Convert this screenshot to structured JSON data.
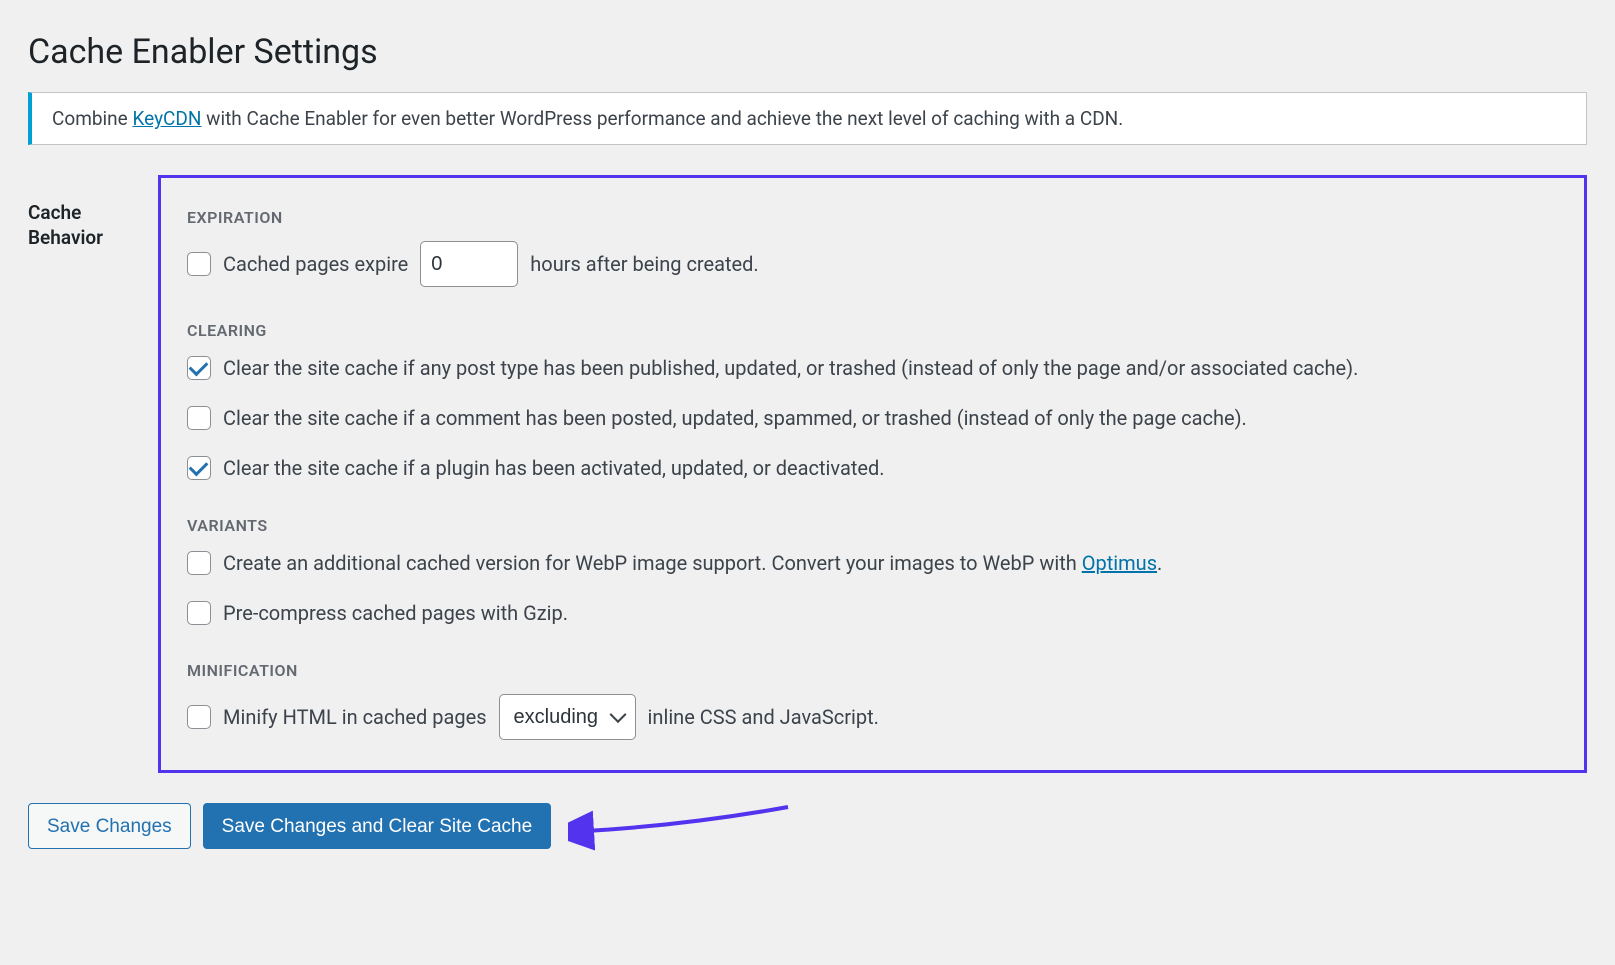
{
  "page": {
    "title": "Cache Enabler Settings"
  },
  "notice": {
    "pre": "Combine ",
    "link_text": "KeyCDN",
    "post": " with Cache Enabler for even better WordPress performance and achieve the next level of caching with a CDN."
  },
  "section_label": "Cache Behavior",
  "expiration": {
    "heading": "EXPIRATION",
    "label_pre": "Cached pages expire",
    "value": "0",
    "label_post": "hours after being created.",
    "checked": false
  },
  "clearing": {
    "heading": "CLEARING",
    "items": [
      {
        "label": "Clear the site cache if any post type has been published, updated, or trashed (instead of only the page and/or associated cache).",
        "checked": true
      },
      {
        "label": "Clear the site cache if a comment has been posted, updated, spammed, or trashed (instead of only the page cache).",
        "checked": false
      },
      {
        "label": "Clear the site cache if a plugin has been activated, updated, or deactivated.",
        "checked": true
      }
    ]
  },
  "variants": {
    "heading": "VARIANTS",
    "webp": {
      "label_pre": "Create an additional cached version for WebP image support. Convert your images to WebP with ",
      "link_text": "Optimus",
      "label_post": ".",
      "checked": false
    },
    "gzip": {
      "label": "Pre-compress cached pages with Gzip.",
      "checked": false
    }
  },
  "minification": {
    "heading": "MINIFICATION",
    "label_pre": "Minify HTML in cached pages",
    "selected": "excluding",
    "label_post": "inline CSS and JavaScript.",
    "checked": false
  },
  "buttons": {
    "save": "Save Changes",
    "save_clear": "Save Changes and Clear Site Cache"
  }
}
